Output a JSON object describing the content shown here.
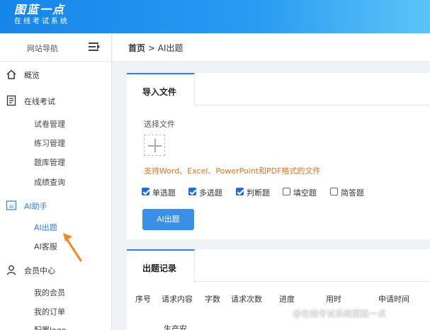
{
  "app": {
    "logo_title": "图蓝一点",
    "logo_subtitle": "在线考试系统"
  },
  "sidebar": {
    "nav_label": "网站导航",
    "groups": [
      {
        "label": "概览",
        "icon": "home-icon"
      },
      {
        "label": "在线考试",
        "icon": "document-list-icon",
        "items": [
          "试卷管理",
          "练习管理",
          "题库管理",
          "成绩查询"
        ]
      },
      {
        "label": "AI助手",
        "icon": "ai-icon",
        "items": [
          "AI出题",
          "AI客服"
        ]
      },
      {
        "label": "会员中心",
        "icon": "user-icon",
        "items": [
          "我的会员",
          "我的订单",
          "配置logo"
        ]
      }
    ],
    "active_item": "AI出题"
  },
  "breadcrumb": {
    "home": "首页",
    "separator": ">",
    "current": "AI出题"
  },
  "import_card": {
    "tab_label": "导入文件",
    "choose_label": "选择文件",
    "hint": "支持Word、Excel、PowerPoint和PDF格式的文件",
    "options": [
      {
        "label": "单选题",
        "checked": true
      },
      {
        "label": "多选题",
        "checked": true
      },
      {
        "label": "判断题",
        "checked": true
      },
      {
        "label": "填空题",
        "checked": false
      },
      {
        "label": "简答题",
        "checked": false
      }
    ],
    "button_label": "AI出题"
  },
  "records_card": {
    "tab_label": "出题记录",
    "columns": [
      "序号",
      "请求内容",
      "字数",
      "请求次数",
      "进度",
      "用时",
      "申请时间"
    ],
    "rows": [
      [
        "",
        "生产安"
      ]
    ]
  },
  "watermark": "@在线考试系统图蓝一点",
  "colors": {
    "header_start": "#1685ea",
    "header_end": "#5bc4f8",
    "accent": "#2f7fdc",
    "hint": "#e8711f",
    "button": "#3a8fe6"
  }
}
